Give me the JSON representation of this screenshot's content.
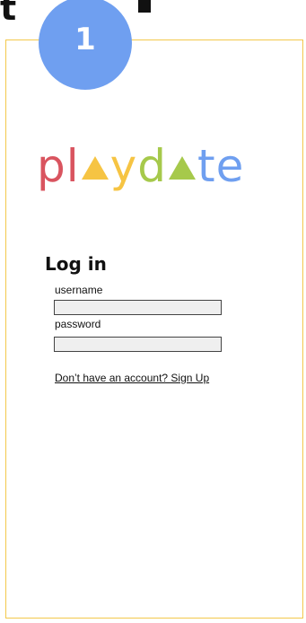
{
  "header": {
    "fragment_text": "t",
    "step_number": "1"
  },
  "logo": {
    "letters": [
      {
        "char": "p",
        "color": "#d9545f"
      },
      {
        "char": "l",
        "color": "#d9545f"
      },
      {
        "triangle": true,
        "color": "#f6c443"
      },
      {
        "char": "y",
        "color": "#f6c443"
      },
      {
        "char": "d",
        "color": "#a6c94b"
      },
      {
        "triangle": true,
        "color": "#a6c94b"
      },
      {
        "char": "t",
        "color": "#6f9ff0"
      },
      {
        "char": "e",
        "color": "#6f9ff0"
      }
    ]
  },
  "login": {
    "title": "Log in",
    "username_label": "username",
    "username_value": "",
    "password_label": "password",
    "password_value": "",
    "signup_link": "Don’t have an account? Sign Up"
  },
  "colors": {
    "frame_border": "#f3c84b",
    "badge": "#6f9ff0"
  }
}
